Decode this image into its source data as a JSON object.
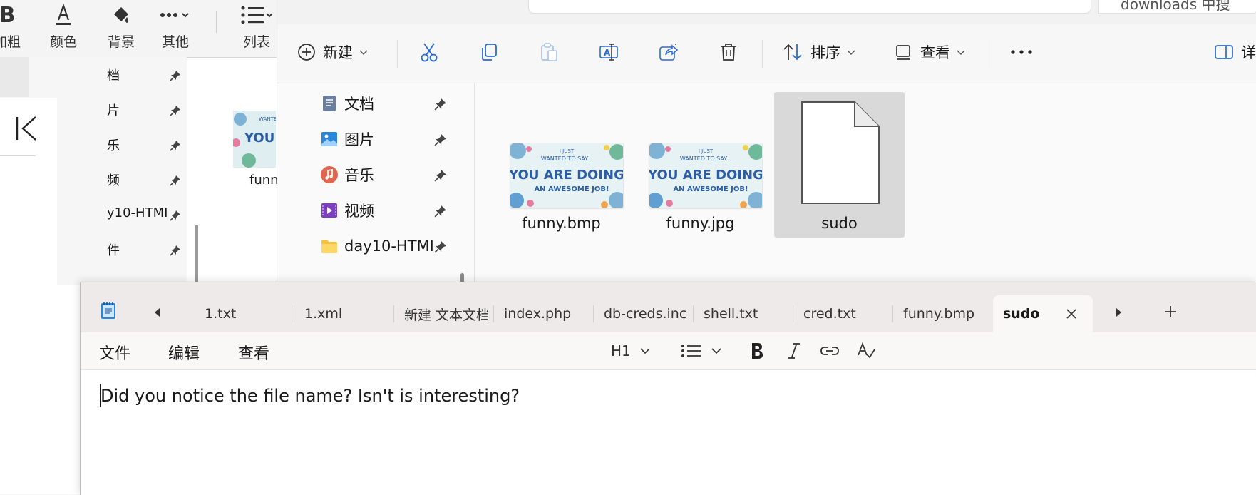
{
  "bg_app": {
    "ribbon": [
      {
        "label": "加粗",
        "icon": "bold-icon"
      },
      {
        "label": "颜色",
        "icon": "font-color-icon"
      },
      {
        "label": "背景",
        "icon": "highlight-icon"
      },
      {
        "label": "其他",
        "icon": "more-icon"
      },
      {
        "label": "列表",
        "icon": "list-icon"
      }
    ],
    "nav": [
      "档",
      "片",
      "乐",
      "频",
      "y10-HTMI",
      "件"
    ],
    "thumb_label": "funny"
  },
  "explorer": {
    "search_text": "downloads 中搜",
    "toolbar": {
      "new_label": "新建",
      "sort_label": "排序",
      "view_label": "查看",
      "details_label": "详"
    },
    "nav": [
      {
        "label": "文档",
        "icon": "documents-icon"
      },
      {
        "label": "图片",
        "icon": "pictures-icon"
      },
      {
        "label": "音乐",
        "icon": "music-icon"
      },
      {
        "label": "视频",
        "icon": "videos-icon"
      },
      {
        "label": "day10-HTMI",
        "icon": "folder-icon"
      }
    ],
    "files": [
      {
        "name": "funny.bmp",
        "type": "image"
      },
      {
        "name": "funny.jpg",
        "type": "image"
      },
      {
        "name": "sudo",
        "type": "blank"
      }
    ],
    "thumb_text": [
      "I JUST",
      "WANTED TO SAY...",
      "YOU ARE DOING",
      "AN AWESOME JOB!"
    ]
  },
  "notepad": {
    "tabs": [
      "1.txt",
      "1.xml",
      "新建 文本文档",
      "index.php",
      "db-creds.inc",
      "shell.txt",
      "cred.txt",
      "funny.bmp",
      "sudo"
    ],
    "active_tab": "sudo",
    "menu": {
      "file": "文件",
      "edit": "编辑",
      "view": "查看"
    },
    "heading_select": "H1",
    "content": "Did you notice the file name? Isn't is interesting?"
  }
}
